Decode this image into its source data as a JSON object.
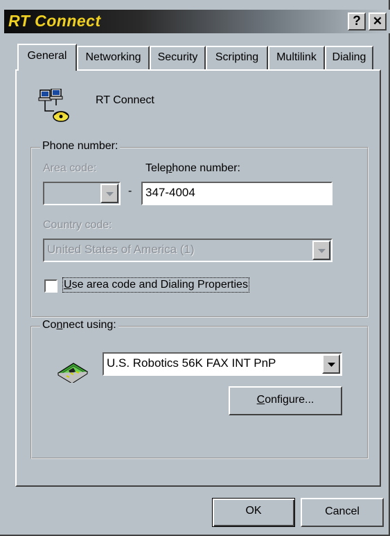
{
  "window": {
    "title": "RT Connect",
    "help_glyph": "?",
    "close_glyph": "✕"
  },
  "tabs": [
    {
      "label": "General",
      "active": true
    },
    {
      "label": "Networking",
      "active": false
    },
    {
      "label": "Security",
      "active": false
    },
    {
      "label": "Scripting",
      "active": false
    },
    {
      "label": "Multilink",
      "active": false
    },
    {
      "label": "Dialing",
      "active": false
    }
  ],
  "general": {
    "connection_name": "RT Connect",
    "connection_icon": "dialup-network-icon",
    "phone_group": {
      "legend": "Phone number:",
      "area_code_label": "Area code:",
      "area_code_value": "",
      "dash": "-",
      "telephone_label_pre": "Tele",
      "telephone_label_accel": "p",
      "telephone_label_post": "hone number:",
      "telephone_value": "347-4004",
      "country_code_label": "Country code:",
      "country_code_value": "United States of America (1)",
      "use_area_code_pre": "",
      "use_area_code_accel": "U",
      "use_area_code_post": "se area code and Dialing Properties",
      "use_area_code_checked": false
    },
    "connect_group": {
      "legend_pre": "Co",
      "legend_accel": "n",
      "legend_post": "nect using:",
      "modem_icon": "modem-card-icon",
      "device_value": "U.S. Robotics 56K FAX INT PnP",
      "configure_accel": "C",
      "configure_post": "onfigure..."
    }
  },
  "footer": {
    "ok_label": "OK",
    "cancel_label": "Cancel"
  }
}
